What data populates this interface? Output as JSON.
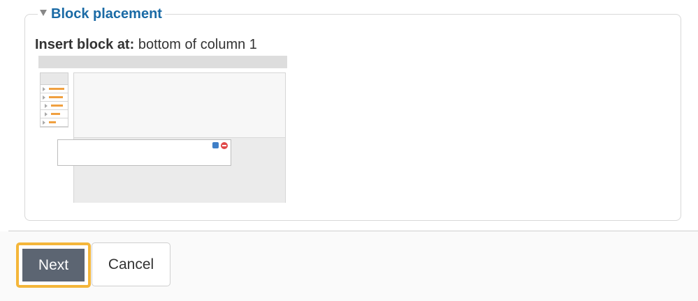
{
  "section": {
    "legend": "Block placement",
    "insert_label": "Insert block at:",
    "insert_value": " bottom of column 1"
  },
  "preview": {
    "column1_items": 5
  },
  "footer": {
    "next_label": "Next",
    "cancel_label": "Cancel"
  },
  "colors": {
    "legend": "#1a6aa5",
    "next_button": "#5c6572",
    "focus_ring": "#f4b63a"
  }
}
